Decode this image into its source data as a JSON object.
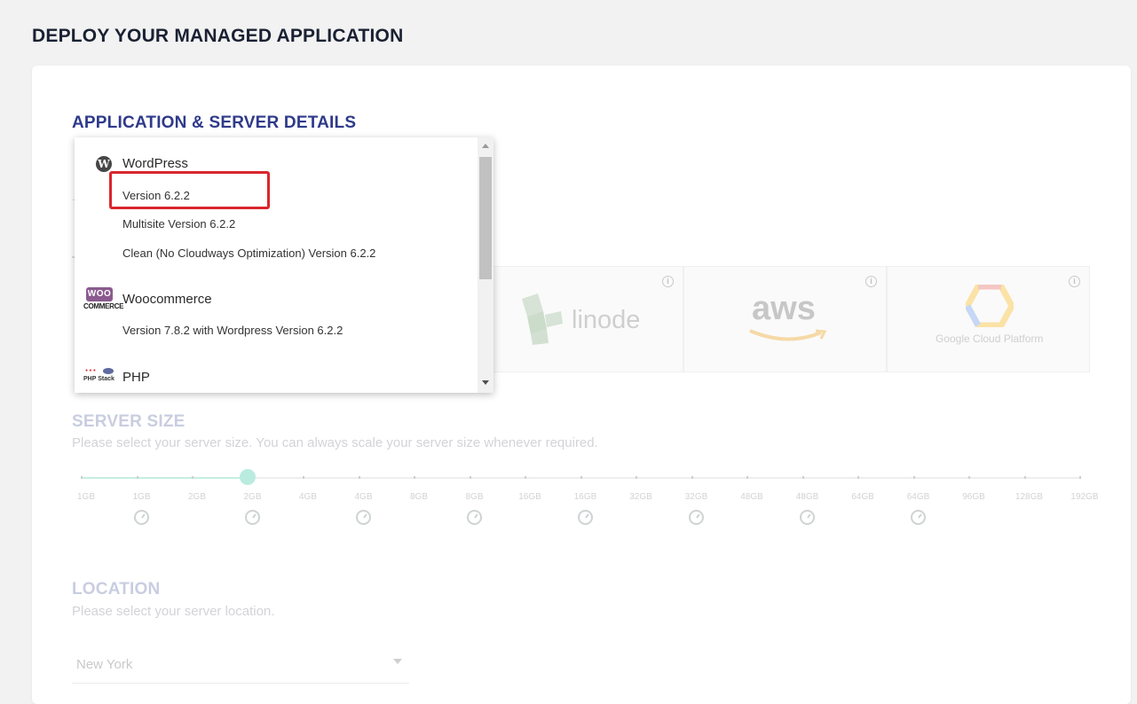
{
  "page": {
    "title": "DEPLOY YOUR MANAGED APPLICATION"
  },
  "app_section": {
    "title": "APPLICATION & SERVER DETAILS"
  },
  "dropdown": {
    "groups": [
      {
        "icon": "wordpress-icon",
        "label": "WordPress",
        "options": [
          "Version 6.2.2",
          "Multisite Version 6.2.2",
          "Clean (No Cloudways Optimization) Version 6.2.2"
        ]
      },
      {
        "icon": "woocommerce-icon",
        "icon_text_top": "WOO",
        "icon_text_bottom": "COMMERCE",
        "label": "Woocommerce",
        "options": [
          "Version 7.8.2 with Wordpress Version 6.2.2"
        ]
      },
      {
        "icon": "php-stack-icon",
        "icon_text": "PHP Stack",
        "label": "PHP",
        "options": []
      }
    ],
    "selected": "Version 6.2.2"
  },
  "providers": [
    {
      "name": "linode",
      "logo_text": "linode"
    },
    {
      "name": "aws",
      "logo_text": "aws"
    },
    {
      "name": "google-cloud",
      "logo_text": "Google Cloud Platform"
    }
  ],
  "server_size": {
    "title": "SERVER SIZE",
    "subtitle": "Please select your server size. You can always scale your server size whenever required.",
    "labels": [
      "1GB",
      "1GB",
      "2GB",
      "2GB",
      "4GB",
      "4GB",
      "8GB",
      "8GB",
      "16GB",
      "16GB",
      "32GB",
      "32GB",
      "48GB",
      "48GB",
      "64GB",
      "64GB",
      "96GB",
      "128GB",
      "192GB"
    ],
    "selected_index": 3
  },
  "location": {
    "title": "LOCATION",
    "subtitle": "Please select your server location.",
    "value": "New York"
  },
  "colors": {
    "title_active": "#2f3a8a",
    "title_faded": "#c9cde0",
    "highlight": "#d9262c",
    "slider_fill": "#b9ecde"
  }
}
